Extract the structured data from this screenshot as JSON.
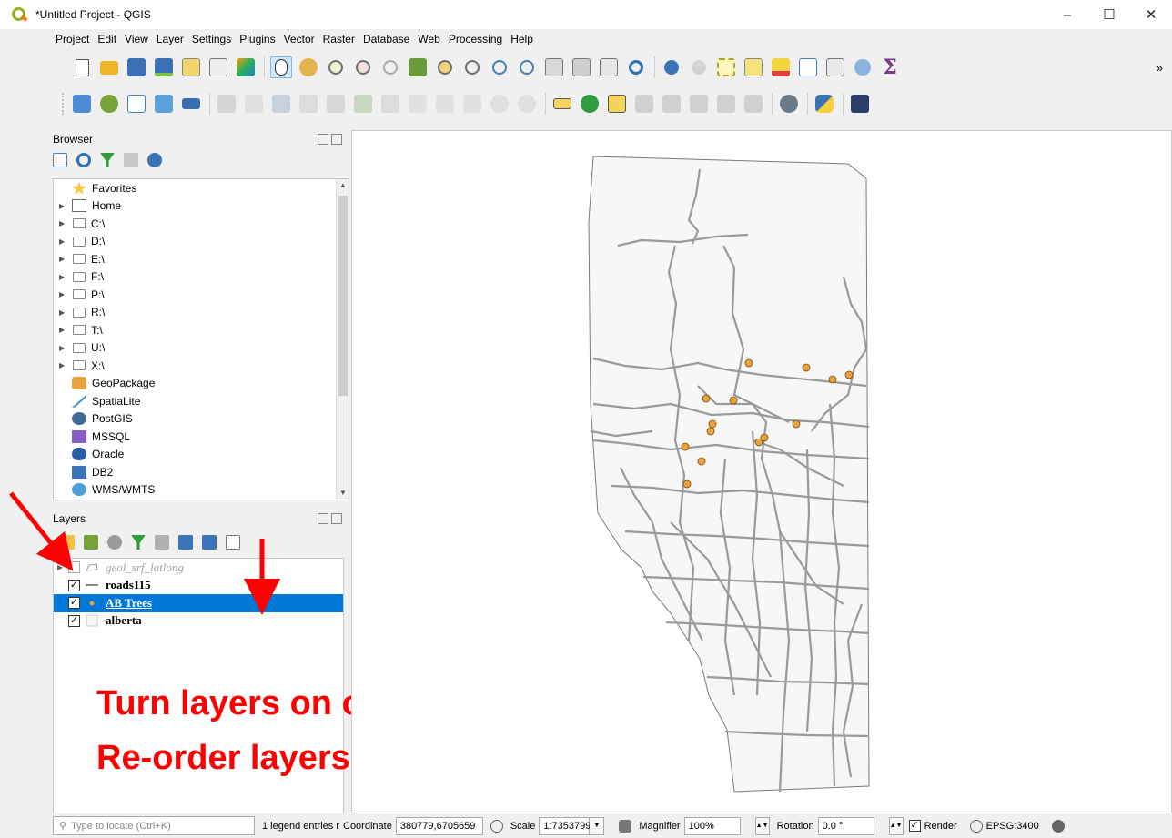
{
  "window": {
    "title": "*Untitled Project - QGIS",
    "controls": [
      "–",
      "☐",
      "✕"
    ]
  },
  "menu": [
    "Project",
    "Edit",
    "View",
    "Layer",
    "Settings",
    "Plugins",
    "Vector",
    "Raster",
    "Database",
    "Web",
    "Processing",
    "Help"
  ],
  "toolbar": {
    "overflow": "»",
    "sigma": "Σ"
  },
  "browser": {
    "title": "Browser",
    "items": [
      {
        "label": "Favorites",
        "icon": "star-icon",
        "expandable": false
      },
      {
        "label": "Home",
        "icon": "home-icon",
        "expandable": true
      },
      {
        "label": "C:\\",
        "icon": "folder-icon",
        "expandable": true
      },
      {
        "label": "D:\\",
        "icon": "folder-icon",
        "expandable": true
      },
      {
        "label": "E:\\",
        "icon": "folder-icon",
        "expandable": true
      },
      {
        "label": "F:\\",
        "icon": "folder-icon",
        "expandable": true
      },
      {
        "label": "P:\\",
        "icon": "folder-icon",
        "expandable": true
      },
      {
        "label": "R:\\",
        "icon": "folder-icon",
        "expandable": true
      },
      {
        "label": "T:\\",
        "icon": "folder-icon",
        "expandable": true
      },
      {
        "label": "U:\\",
        "icon": "folder-icon",
        "expandable": true
      },
      {
        "label": "X:\\",
        "icon": "folder-icon",
        "expandable": true
      },
      {
        "label": "GeoPackage",
        "icon": "geopackage-icon",
        "expandable": false
      },
      {
        "label": "SpatiaLite",
        "icon": "spatialite-icon",
        "expandable": false
      },
      {
        "label": "PostGIS",
        "icon": "postgis-icon",
        "expandable": false
      },
      {
        "label": "MSSQL",
        "icon": "mssql-icon",
        "expandable": false
      },
      {
        "label": "Oracle",
        "icon": "oracle-icon",
        "expandable": false
      },
      {
        "label": "DB2",
        "icon": "db2-icon",
        "expandable": false
      },
      {
        "label": "WMS/WMTS",
        "icon": "wms-icon",
        "expandable": false
      }
    ]
  },
  "layers": {
    "title": "Layers",
    "items": [
      {
        "name": "geol_srf_latlong",
        "checked": false,
        "style": "disabled",
        "expandable": true
      },
      {
        "name": "roads115",
        "checked": true,
        "style": "normal",
        "expandable": false
      },
      {
        "name": "AB Trees",
        "checked": true,
        "style": "selected",
        "expandable": false
      },
      {
        "name": "alberta",
        "checked": true,
        "style": "normal",
        "expandable": false
      }
    ]
  },
  "annotation": {
    "line1": "Turn layers on or off",
    "line2": "Re-order layers",
    "color": "#ff0000"
  },
  "statusbar": {
    "locator_placeholder": "Type to locate (Ctrl+K)",
    "legend_msg": "1 legend entries r",
    "coordinate_label": "Coordinate",
    "coordinate_value": "380779,6705659",
    "scale_label": "Scale",
    "scale_value": "1:7353799",
    "magnifier_label": "Magnifier",
    "magnifier_value": "100%",
    "rotation_label": "Rotation",
    "rotation_value": "0.0 °",
    "render_label": "Render",
    "render_checked": true,
    "crs": "EPSG:3400"
  },
  "colors": {
    "selected": "#0078d7",
    "road": "#9a9a9a",
    "tree_point": "#e8a33c",
    "province_fill": "#f7f7f7"
  }
}
